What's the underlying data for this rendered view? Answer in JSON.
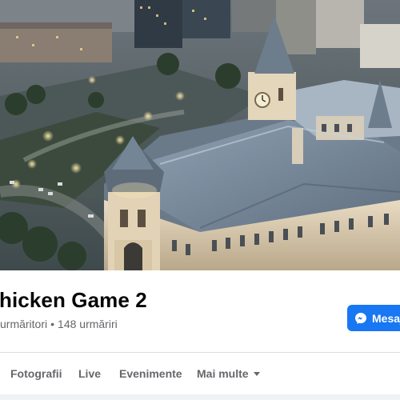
{
  "cover": {
    "image_alt": "cover-photo-palace-of-culture"
  },
  "profile": {
    "name": "hicken Game 2",
    "followers_text": "urmăritori",
    "separator": "•",
    "following_text": "148 urmăriri"
  },
  "actions": {
    "message_label": "Mesaj",
    "message_icon": "messenger-icon"
  },
  "tabs": {
    "items": [
      {
        "label": "Fotografii"
      },
      {
        "label": "Live"
      },
      {
        "label": "Evenimente"
      },
      {
        "label": "Mai multe",
        "icon": "caret-down-icon"
      }
    ]
  },
  "colors": {
    "accent": "#1877f2",
    "text_primary": "#050505",
    "text_secondary": "#65676b",
    "divider": "#dadde1"
  }
}
